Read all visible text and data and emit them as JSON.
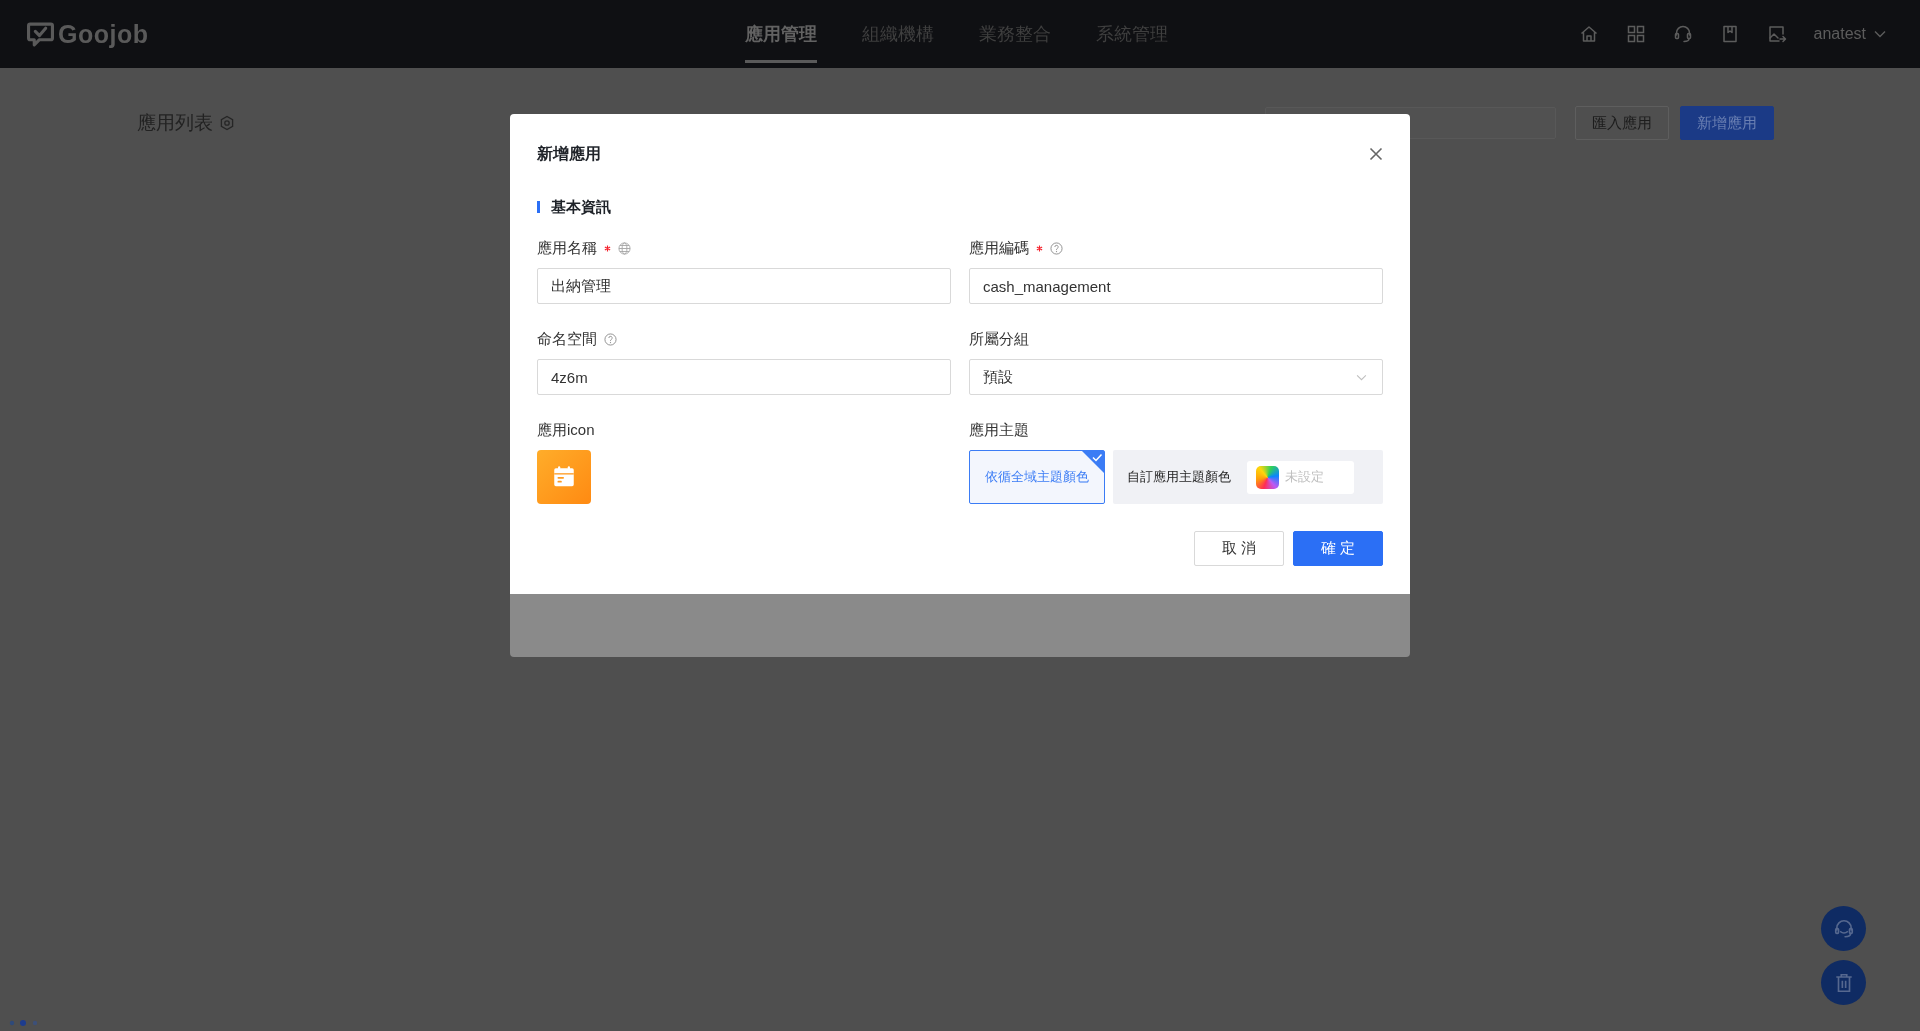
{
  "header": {
    "logo": "Goojob",
    "nav": [
      {
        "label": "應用管理",
        "selected": true
      },
      {
        "label": "組織機構",
        "selected": false
      },
      {
        "label": "業務整合",
        "selected": false
      },
      {
        "label": "系統管理",
        "selected": false
      }
    ],
    "user": "anatest"
  },
  "page": {
    "title": "應用列表",
    "buttons": [
      {
        "kind": "default",
        "label": "匯入應用"
      },
      {
        "kind": "primary",
        "label": "新增應用"
      }
    ]
  },
  "dialog": {
    "title": "新增應用",
    "section": "基本資訊",
    "fields": [
      {
        "kind": "text",
        "label": "應用名稱",
        "required": true,
        "hint": {
          "kind": "globe"
        },
        "value": "出納管理"
      },
      {
        "kind": "text",
        "label": "應用編碼",
        "required": true,
        "hint": {
          "kind": "help"
        },
        "value": "cash_management"
      },
      {
        "kind": "text",
        "label": "命名空間",
        "required": false,
        "hint": {
          "kind": "help"
        },
        "value": "4z6m"
      },
      {
        "kind": "select",
        "label": "所屬分組",
        "required": false,
        "value": "預設"
      }
    ],
    "icon_label": "應用icon",
    "theme": {
      "label": "應用主題",
      "options": [
        {
          "kind": "preset",
          "label": "依循全域主題顏色",
          "selected": true
        },
        {
          "kind": "custom",
          "label": "自訂應用主題顏色",
          "placeholder": "未設定",
          "selected": false
        }
      ]
    },
    "buttons": [
      {
        "kind": "default",
        "label": "取 消"
      },
      {
        "kind": "primary",
        "label": "確 定"
      }
    ]
  }
}
